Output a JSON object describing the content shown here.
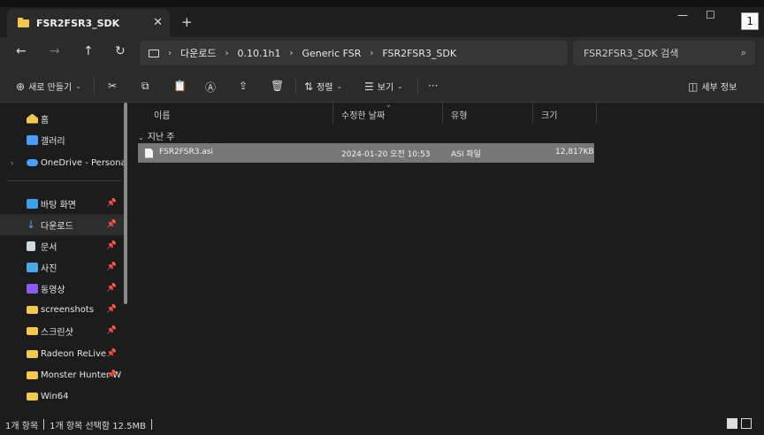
{
  "tab": {
    "title": "FSR2FSR3_SDK",
    "close": "✕",
    "new": "+"
  },
  "window": {
    "minimize": "—",
    "maximize": "☐",
    "badge": "1"
  },
  "nav": {
    "back": "←",
    "forward": "→",
    "up": "↑",
    "refresh": "↻",
    "breadcrumbs": [
      "다운로드",
      "0.10.1h1",
      "Generic FSR",
      "FSR2FSR3_SDK"
    ],
    "search_placeholder": "FSR2FSR3_SDK 검색",
    "search_icon": "⌕"
  },
  "commands": {
    "new": "새로 만들기",
    "sort": "정렬",
    "view": "보기",
    "more": "···",
    "details": "세부 정보"
  },
  "sidebar": {
    "items": [
      {
        "label": "홈",
        "icon": "home-icon"
      },
      {
        "label": "갤러리",
        "icon": "gallery-icon"
      },
      {
        "label": "OneDrive - Personal",
        "icon": "cloud-icon"
      },
      {
        "label": "바탕 화면",
        "icon": "desktop-icon"
      },
      {
        "label": "다운로드",
        "icon": "download-icon"
      },
      {
        "label": "문서",
        "icon": "document-icon"
      },
      {
        "label": "사진",
        "icon": "pictures-icon"
      },
      {
        "label": "동영상",
        "icon": "video-icon"
      },
      {
        "label": "screenshots",
        "icon": "folder-icon"
      },
      {
        "label": "스크린샷",
        "icon": "folder-icon"
      },
      {
        "label": "Radeon ReLive",
        "icon": "folder-icon"
      },
      {
        "label": "Monster Hunter W",
        "icon": "folder-icon"
      },
      {
        "label": "Win64",
        "icon": "folder-icon"
      }
    ]
  },
  "columns": {
    "name": "이름",
    "modified": "수정한 날짜",
    "type": "유형",
    "size": "크기"
  },
  "group_label": "지난 주",
  "files": [
    {
      "name": "FSR2FSR3.asi",
      "modified": "2024-01-20 오전 10:53",
      "type": "ASI 파일",
      "size": "12,817KB"
    }
  ],
  "status": {
    "count": "1개 항목",
    "selected": "1개 항목 선택함 12.5MB"
  },
  "colors": {
    "folder": "#f2c94c",
    "selection": "#777777",
    "accent": "#4a9eff"
  }
}
